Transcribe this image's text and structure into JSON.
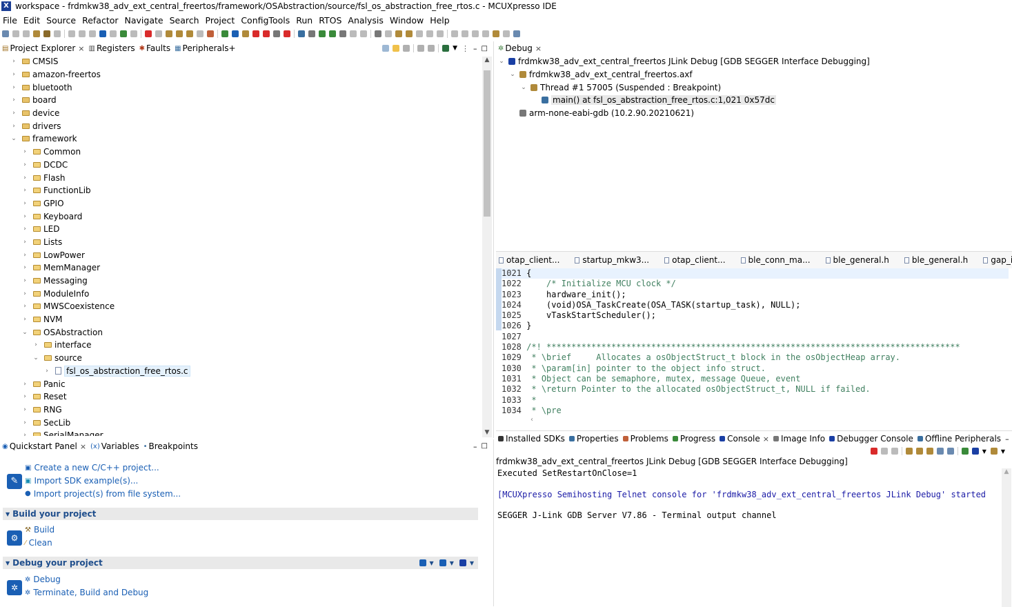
{
  "window": {
    "title": "workspace - frdmkw38_adv_ext_central_freertos/framework/OSAbstraction/source/fsl_os_abstraction_free_rtos.c - MCUXpresso IDE"
  },
  "menu": [
    "File",
    "Edit",
    "Source",
    "Refactor",
    "Navigate",
    "Search",
    "Project",
    "ConfigTools",
    "Run",
    "RTOS",
    "Analysis",
    "Window",
    "Help"
  ],
  "left_tabs": [
    {
      "label": "Project Explorer",
      "close": "×"
    },
    {
      "label": "Registers"
    },
    {
      "label": "Faults"
    },
    {
      "label": "Peripherals+"
    }
  ],
  "project_tree": [
    {
      "label": "CMSIS",
      "depth": 0,
      "chev": "›",
      "icon": "pkg"
    },
    {
      "label": "amazon-freertos",
      "depth": 0,
      "chev": "›",
      "icon": "pkg"
    },
    {
      "label": "bluetooth",
      "depth": 0,
      "chev": "›",
      "icon": "pkg"
    },
    {
      "label": "board",
      "depth": 0,
      "chev": "›",
      "icon": "pkg"
    },
    {
      "label": "device",
      "depth": 0,
      "chev": "›",
      "icon": "pkg"
    },
    {
      "label": "drivers",
      "depth": 0,
      "chev": "›",
      "icon": "pkg"
    },
    {
      "label": "framework",
      "depth": 0,
      "chev": "⌄",
      "icon": "pkg"
    },
    {
      "label": "Common",
      "depth": 1,
      "chev": "›",
      "icon": "folder"
    },
    {
      "label": "DCDC",
      "depth": 1,
      "chev": "›",
      "icon": "folder"
    },
    {
      "label": "Flash",
      "depth": 1,
      "chev": "›",
      "icon": "folder"
    },
    {
      "label": "FunctionLib",
      "depth": 1,
      "chev": "›",
      "icon": "folder"
    },
    {
      "label": "GPIO",
      "depth": 1,
      "chev": "›",
      "icon": "folder"
    },
    {
      "label": "Keyboard",
      "depth": 1,
      "chev": "›",
      "icon": "folder"
    },
    {
      "label": "LED",
      "depth": 1,
      "chev": "›",
      "icon": "folder"
    },
    {
      "label": "Lists",
      "depth": 1,
      "chev": "›",
      "icon": "folder"
    },
    {
      "label": "LowPower",
      "depth": 1,
      "chev": "›",
      "icon": "folder"
    },
    {
      "label": "MemManager",
      "depth": 1,
      "chev": "›",
      "icon": "folder"
    },
    {
      "label": "Messaging",
      "depth": 1,
      "chev": "›",
      "icon": "folder"
    },
    {
      "label": "ModuleInfo",
      "depth": 1,
      "chev": "›",
      "icon": "folder"
    },
    {
      "label": "MWSCoexistence",
      "depth": 1,
      "chev": "›",
      "icon": "folder"
    },
    {
      "label": "NVM",
      "depth": 1,
      "chev": "›",
      "icon": "folder"
    },
    {
      "label": "OSAbstraction",
      "depth": 1,
      "chev": "⌄",
      "icon": "folder"
    },
    {
      "label": "interface",
      "depth": 2,
      "chev": "›",
      "icon": "folder"
    },
    {
      "label": "source",
      "depth": 2,
      "chev": "⌄",
      "icon": "folder"
    },
    {
      "label": "fsl_os_abstraction_free_rtos.c",
      "depth": 3,
      "chev": "›",
      "icon": "file",
      "selected": true
    },
    {
      "label": "Panic",
      "depth": 1,
      "chev": "›",
      "icon": "folder"
    },
    {
      "label": "Reset",
      "depth": 1,
      "chev": "›",
      "icon": "folder"
    },
    {
      "label": "RNG",
      "depth": 1,
      "chev": "›",
      "icon": "folder"
    },
    {
      "label": "SecLib",
      "depth": 1,
      "chev": "›",
      "icon": "folder"
    },
    {
      "label": "SerialManager",
      "depth": 1,
      "chev": "›",
      "icon": "folder"
    }
  ],
  "debug": {
    "tab": "Debug",
    "close": "×",
    "tree": [
      {
        "label": "frdmkw38_adv_ext_central_freertos JLink Debug [GDB SEGGER Interface Debugging]",
        "depth": 0,
        "chev": "⌄"
      },
      {
        "label": "frdmkw38_adv_ext_central_freertos.axf",
        "depth": 1,
        "chev": "⌄"
      },
      {
        "label": "Thread #1 57005 (Suspended : Breakpoint)",
        "depth": 2,
        "chev": "⌄"
      },
      {
        "label": "main() at fsl_os_abstraction_free_rtos.c:1,021 0x57dc",
        "depth": 3,
        "chev": "",
        "selected": true
      },
      {
        "label": "arm-none-eabi-gdb (10.2.90.20210621)",
        "depth": 1,
        "chev": ""
      }
    ]
  },
  "editor_tabs": [
    "otap_client...",
    "startup_mkw3...",
    "otap_client...",
    "ble_conn_ma...",
    "ble_general.h",
    "ble_general.h",
    "gap_interface.h"
  ],
  "code": [
    {
      "n": "1021",
      "t": "{"
    },
    {
      "n": "1022",
      "t": "    /* Initialize MCU clock */"
    },
    {
      "n": "1023",
      "t": "    hardware_init();"
    },
    {
      "n": "1024",
      "t": "    (void)OSA_TaskCreate(OSA_TASK(startup_task), NULL);"
    },
    {
      "n": "1025",
      "t": "    vTaskStartScheduler();"
    },
    {
      "n": "1026",
      "t": "}"
    },
    {
      "n": "1027",
      "t": ""
    },
    {
      "n": "1028",
      "t": "/*! ***********************************************************************************"
    },
    {
      "n": "1029",
      "t": " * \\brief     Allocates a osObjectStruct_t block in the osObjectHeap array."
    },
    {
      "n": "1030",
      "t": " * \\param[in] pointer to the object info struct."
    },
    {
      "n": "1031",
      "t": " * Object can be semaphore, mutex, message Queue, event"
    },
    {
      "n": "1032",
      "t": " * \\return Pointer to the allocated osObjectStruct_t, NULL if failed."
    },
    {
      "n": "1033",
      "t": " *"
    },
    {
      "n": "1034",
      "t": " * \\pre"
    }
  ],
  "quickstart": {
    "tabs": [
      "Quickstart Panel",
      "Variables",
      "Breakpoints"
    ],
    "close": "×",
    "links_top": [
      "Create a new C/C++ project...",
      "Import SDK example(s)...",
      "Import project(s) from file system..."
    ],
    "build_head": "Build your project",
    "build_links": [
      "Build",
      "Clean"
    ],
    "debug_head": "Debug your project",
    "debug_links": [
      "Debug",
      "Terminate, Build and Debug"
    ]
  },
  "bottom_tabs": [
    "Installed SDKs",
    "Properties",
    "Problems",
    "Progress",
    "Console",
    "Image Info",
    "Debugger Console",
    "Offline Peripherals"
  ],
  "console": {
    "header": "frdmkw38_adv_ext_central_freertos JLink Debug [GDB SEGGER Interface Debugging]",
    "lines": [
      {
        "t": "Executed SetRestartOnClose=1",
        "c": ""
      },
      {
        "t": "",
        "c": ""
      },
      {
        "t": "[MCUXpresso Semihosting Telnet console for 'frdmkw38_adv_ext_central_freertos JLink Debug' started",
        "c": "blue"
      },
      {
        "t": "",
        "c": ""
      },
      {
        "t": "SEGGER J-Link GDB Server V7.86 - Terminal output channel",
        "c": ""
      }
    ]
  }
}
